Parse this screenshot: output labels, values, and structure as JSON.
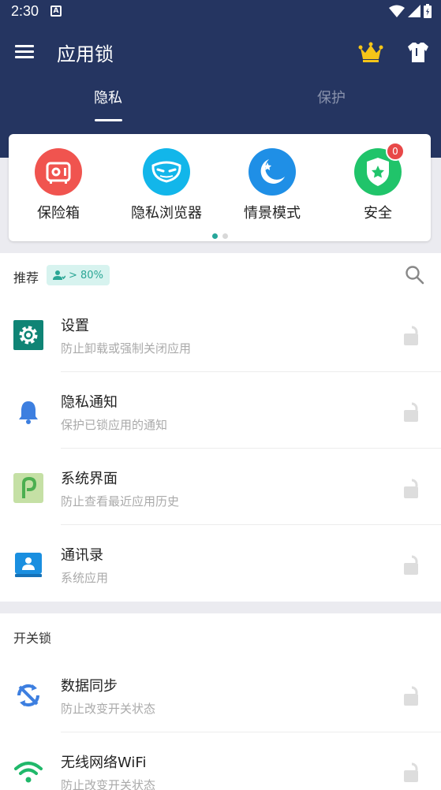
{
  "status_bar": {
    "time": "2:30",
    "a_icon": "A"
  },
  "app_bar": {
    "title": "应用锁",
    "menu_icon": "menu-icon",
    "crown_icon": "crown-icon",
    "shirt_icon": "shirt-icon"
  },
  "tabs": [
    {
      "label": "隐私",
      "active": true
    },
    {
      "label": "保护",
      "active": false
    }
  ],
  "features": [
    {
      "label": "保险箱",
      "icon": "safe-icon",
      "color": "#f0544f"
    },
    {
      "label": "隐私浏览器",
      "icon": "mask-icon",
      "color": "#12b6ea"
    },
    {
      "label": "情景模式",
      "icon": "moon-icon",
      "color": "#1f8fe6"
    },
    {
      "label": "安全",
      "icon": "shield-icon",
      "color": "#20c46a",
      "badge": "0"
    }
  ],
  "pager": {
    "pages": 2,
    "current": 1
  },
  "recommended": {
    "title": "推荐",
    "badge": "> 80%",
    "items": [
      {
        "title": "设置",
        "subtitle": "防止卸载或强制关闭应用",
        "icon": "settings-gear-icon"
      },
      {
        "title": "隐私通知",
        "subtitle": "保护已锁应用的通知",
        "icon": "bell-icon"
      },
      {
        "title": "系统界面",
        "subtitle": "防止查看最近应用历史",
        "icon": "android-p-icon"
      },
      {
        "title": "通讯录",
        "subtitle": "系统应用",
        "icon": "contacts-icon"
      }
    ]
  },
  "switch_lock": {
    "title": "开关锁",
    "items": [
      {
        "title": "数据同步",
        "subtitle": "防止改变开关状态",
        "icon": "sync-icon"
      },
      {
        "title": "无线网络WiFi",
        "subtitle": "防止改变开关状态",
        "icon": "wifi-icon"
      }
    ]
  },
  "colors": {
    "header": "#253561",
    "accent": "#2aa695"
  }
}
